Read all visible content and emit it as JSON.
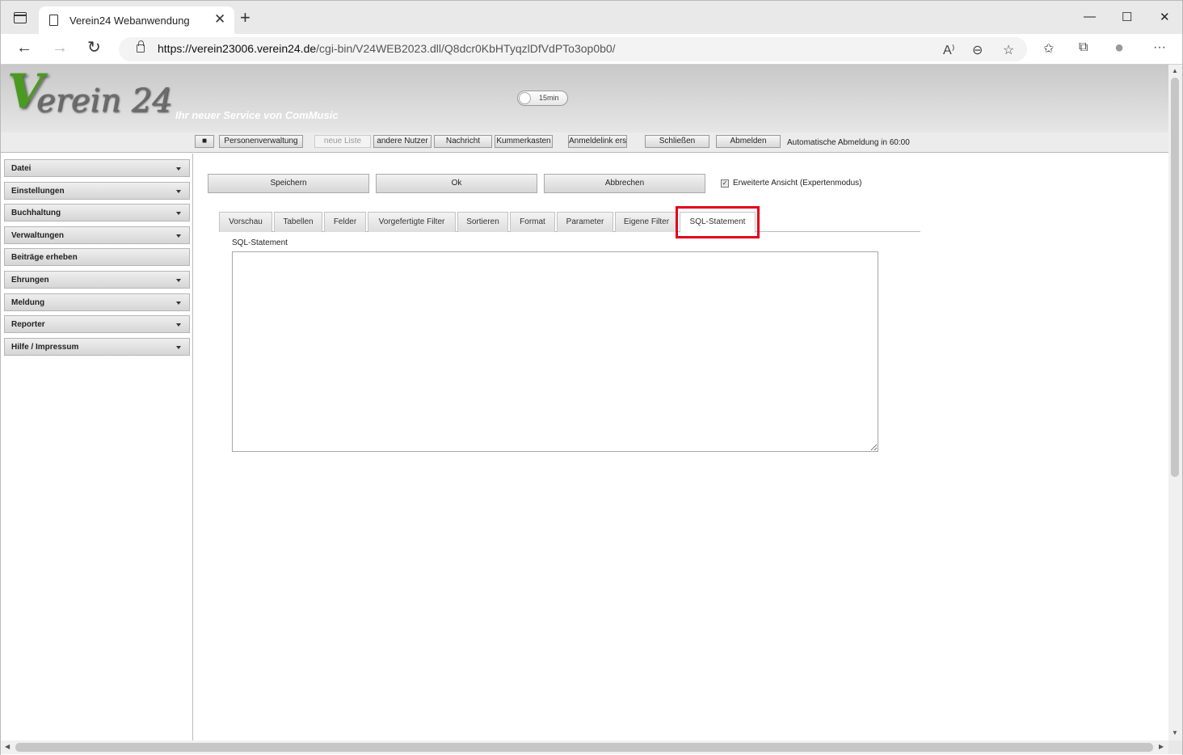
{
  "browser": {
    "tab_title": "Verein24 Webanwendung",
    "tab_close": "✕",
    "new_tab": "+",
    "url_host": "https://verein23006.verein24.de",
    "url_path": "/cgi-bin/V24WEB2023.dll/Q8dcr0KbHTyqzlDfVdPTo3op0b0/",
    "minimize": "—",
    "maximize": "☐",
    "close": "✕",
    "back": "←",
    "forward": "→",
    "reload": "↻",
    "read_aloud": "A⁾",
    "zoom": "⊖",
    "add_favorite": "☆",
    "favorites": "✩",
    "collections": "⧉",
    "profile": "●",
    "more": "···"
  },
  "header": {
    "logo_v": "V",
    "logo_rest": "erein 24",
    "tagline": "Ihr neuer Service von ComMusic",
    "timer_label": "15min"
  },
  "toolbar": {
    "square_btn": "■",
    "buttons": [
      "Personenverwaltung",
      "neue Liste",
      "andere Nutzer",
      "Nachricht",
      "Kummerkasten",
      "Anmeldelink erst",
      "Schließen",
      "Abmelden"
    ],
    "status": "Automatische Abmeldung in 60:00"
  },
  "sidebar": {
    "items": [
      "Datei",
      "Einstellungen",
      "Buchhaltung",
      "Verwaltungen",
      "Beiträge erheben",
      "Ehrungen",
      "Meldung",
      "Reporter",
      "Hilfe / Impressum"
    ]
  },
  "main": {
    "save": "Speichern",
    "ok": "Ok",
    "cancel": "Abbrechen",
    "expert_mode": "Erweiterte Ansicht (Expertenmodus)",
    "expert_checked": true,
    "tabs": [
      "Vorschau",
      "Tabellen",
      "Felder",
      "Vorgefertigte Filter",
      "Sortieren",
      "Format",
      "Parameter",
      "Eigene Filter",
      "SQL-Statement"
    ],
    "active_tab": "SQL-Statement",
    "sql_label": "SQL-Statement",
    "sql_value": ""
  },
  "colors": {
    "highlight": "#e3001b",
    "logo_green": "#4a9a22"
  }
}
